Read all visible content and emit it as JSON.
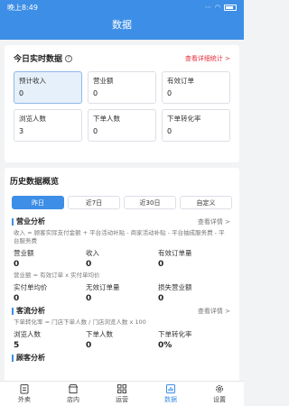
{
  "status": {
    "time": "晚上8:49",
    "signal": "⋯"
  },
  "header": {
    "title": "数据"
  },
  "realtime": {
    "title": "今日实时数据",
    "detail_link": "查看详细统计 >",
    "metrics": [
      {
        "label": "预计收入",
        "value": "0"
      },
      {
        "label": "营业额",
        "value": "0"
      },
      {
        "label": "有效订单",
        "value": "0"
      },
      {
        "label": "浏览人数",
        "value": "3"
      },
      {
        "label": "下单人数",
        "value": "0"
      },
      {
        "label": "下单转化率",
        "value": "0"
      }
    ]
  },
  "history": {
    "title": "历史数据概览",
    "tabs": [
      "昨日",
      "近7日",
      "近30日",
      "自定义"
    ],
    "business": {
      "title": "营业分析",
      "link": "查看详情 >",
      "formula1": "收入 = 顾客实际支付金额 + 平台活动补贴 - 商家活动补贴 - 平台抽成服务费 - 平台服务费",
      "row1": [
        {
          "label": "营业额",
          "value": "0"
        },
        {
          "label": "收入",
          "value": "0"
        },
        {
          "label": "有效订单量",
          "value": "0"
        }
      ],
      "formula2": "营业额 = 有效订单 x 实付单均价",
      "row2": [
        {
          "label": "实付单均价",
          "value": "0"
        },
        {
          "label": "无效订单量",
          "value": "0"
        },
        {
          "label": "损失营业额",
          "value": "0"
        }
      ]
    },
    "traffic": {
      "title": "客流分析",
      "link": "查看详情 >",
      "formula": "下单转化率 = 门店下单人数 / 门店浏览人数 x 100",
      "row": [
        {
          "label": "浏览人数",
          "value": "5"
        },
        {
          "label": "下单人数",
          "value": "0"
        },
        {
          "label": "下单转化率",
          "value": "0%"
        }
      ]
    },
    "next_section_title": "顾客分析"
  },
  "tabbar": [
    {
      "label": "外卖",
      "icon": "clipboard-icon"
    },
    {
      "label": "店内",
      "icon": "store-icon"
    },
    {
      "label": "运营",
      "icon": "grid-icon"
    },
    {
      "label": "数据",
      "icon": "chart-icon"
    },
    {
      "label": "设置",
      "icon": "gear-icon"
    }
  ]
}
